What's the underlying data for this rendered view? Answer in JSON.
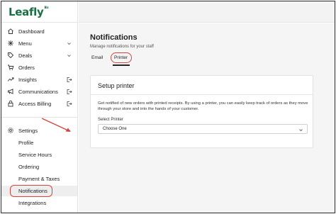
{
  "brand": {
    "logo_text": "Leafly",
    "logo_sup": "Biz"
  },
  "sidebar": {
    "items": [
      {
        "label": "Dashboard",
        "icon": "home-icon"
      },
      {
        "label": "Menu",
        "icon": "grid-icon"
      },
      {
        "label": "Deals",
        "icon": "tag-icon"
      },
      {
        "label": "Orders",
        "icon": "cart-icon"
      },
      {
        "label": "Insights",
        "icon": "trend-icon"
      },
      {
        "label": "Communications",
        "icon": "megaphone-icon"
      },
      {
        "label": "Access Billing",
        "icon": "lock-icon"
      },
      {
        "label": "Settings",
        "icon": "gear-icon"
      }
    ],
    "settings_sub": [
      {
        "label": "Profile"
      },
      {
        "label": "Service Hours"
      },
      {
        "label": "Ordering"
      },
      {
        "label": "Payment & Taxes"
      },
      {
        "label": "Notifications"
      },
      {
        "label": "Integrations"
      }
    ]
  },
  "main": {
    "title": "Notifications",
    "subtitle": "Manage notifications for your staff",
    "tabs": [
      {
        "label": "Email"
      },
      {
        "label": "Printer"
      }
    ],
    "active_tab": "Printer",
    "card": {
      "title": "Setup printer",
      "description": "Get notified of new orders with printed receipts. By using a printer, you can easily keep track of orders as they move through your store and into the hands of your customer.",
      "field_label": "Select Printer",
      "select_value": "Choose One"
    }
  },
  "colors": {
    "brand": "#1b6e43",
    "annotation": "#d6443b",
    "active_bg": "#eeeeee"
  }
}
